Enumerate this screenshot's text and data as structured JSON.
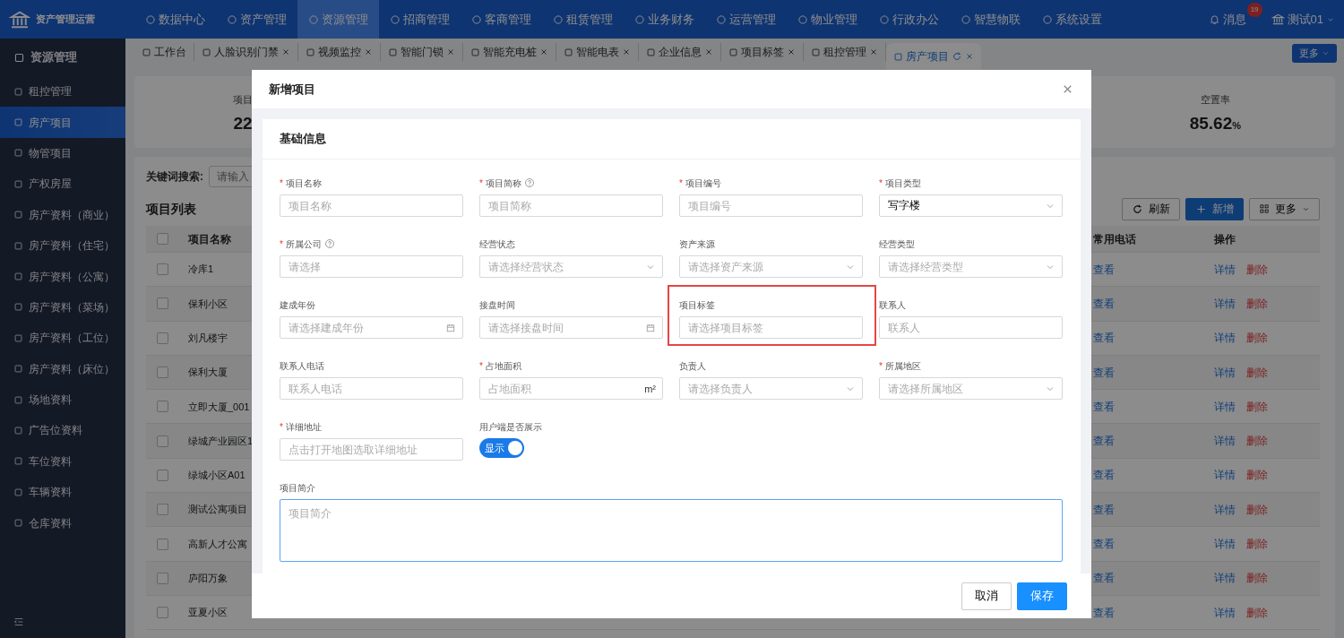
{
  "header": {
    "app_title": "资产管理运营",
    "menu": [
      {
        "label": "数据中心",
        "selected": false
      },
      {
        "label": "资产管理",
        "selected": false
      },
      {
        "label": "资源管理",
        "selected": true
      },
      {
        "label": "招商管理",
        "selected": false
      },
      {
        "label": "客商管理",
        "selected": false
      },
      {
        "label": "租赁管理",
        "selected": false
      },
      {
        "label": "业务财务",
        "selected": false
      },
      {
        "label": "运营管理",
        "selected": false
      },
      {
        "label": "物业管理",
        "selected": false
      },
      {
        "label": "行政办公",
        "selected": false
      },
      {
        "label": "智慧物联",
        "selected": false
      },
      {
        "label": "系统设置",
        "selected": false
      }
    ],
    "messages": {
      "label": "消息",
      "count": "19"
    },
    "user": "测试01"
  },
  "sidebar": {
    "title": "资源管理",
    "items": [
      {
        "label": "租控管理",
        "selected": false
      },
      {
        "label": "房产项目",
        "selected": true
      },
      {
        "label": "物管项目",
        "selected": false
      },
      {
        "label": "产权房屋",
        "selected": false
      },
      {
        "label": "房产资料（商业）",
        "selected": false
      },
      {
        "label": "房产资料（住宅）",
        "selected": false
      },
      {
        "label": "房产资料（公寓）",
        "selected": false
      },
      {
        "label": "房产资料（菜场）",
        "selected": false
      },
      {
        "label": "房产资料（工位）",
        "selected": false
      },
      {
        "label": "房产资料（床位）",
        "selected": false
      },
      {
        "label": "场地资料",
        "selected": false
      },
      {
        "label": "广告位资料",
        "selected": false
      },
      {
        "label": "车位资料",
        "selected": false
      },
      {
        "label": "车辆资料",
        "selected": false
      },
      {
        "label": "仓库资料",
        "selected": false
      }
    ]
  },
  "tabs": [
    {
      "label": "工作台",
      "selected": false,
      "closable": false
    },
    {
      "label": "人脸识别门禁",
      "selected": false,
      "closable": true
    },
    {
      "label": "视频监控",
      "selected": false,
      "closable": true
    },
    {
      "label": "智能门锁",
      "selected": false,
      "closable": true
    },
    {
      "label": "智能充电桩",
      "selected": false,
      "closable": true
    },
    {
      "label": "智能电表",
      "selected": false,
      "closable": true
    },
    {
      "label": "企业信息",
      "selected": false,
      "closable": true
    },
    {
      "label": "项目标签",
      "selected": false,
      "closable": true
    },
    {
      "label": "租控管理",
      "selected": false,
      "closable": true
    },
    {
      "label": "房产项目",
      "selected": true,
      "closable": true
    }
  ],
  "tabs_more": "更多",
  "stats": [
    {
      "label": "项目",
      "value": "22"
    },
    {
      "label": "空置率",
      "value": "85.62",
      "unit": "%"
    }
  ],
  "search": {
    "label": "关键词搜索:",
    "placeholder": "请输入"
  },
  "list": {
    "title": "项目列表",
    "buttons": [
      {
        "label": "刷新",
        "kind": "refresh"
      },
      {
        "label": "新增",
        "kind": "add"
      },
      {
        "label": "更多",
        "kind": "more"
      }
    ],
    "all_checked": false,
    "columns": [
      "项目名称",
      "常用电话",
      "操作"
    ],
    "rows": [
      {
        "name": "冷库1",
        "checked": false,
        "phone": "查看",
        "actions": [
          "详情",
          "删除"
        ]
      },
      {
        "name": "保利小区",
        "checked": false,
        "phone": "查看",
        "actions": [
          "详情",
          "删除"
        ]
      },
      {
        "name": "刘凡楼宇",
        "checked": false,
        "phone": "查看",
        "actions": [
          "详情",
          "删除"
        ]
      },
      {
        "name": "保利大厦",
        "checked": false,
        "phone": "查看",
        "actions": [
          "详情",
          "删除"
        ]
      },
      {
        "name": "立即大厦_001",
        "checked": false,
        "phone": "查看",
        "actions": [
          "详情",
          "删除"
        ]
      },
      {
        "name": "绿城产业园区1",
        "checked": false,
        "phone": "查看",
        "actions": [
          "详情",
          "删除"
        ]
      },
      {
        "name": "绿城小区A01",
        "checked": false,
        "phone": "查看",
        "actions": [
          "详情",
          "删除"
        ]
      },
      {
        "name": "测试公寓项目",
        "checked": false,
        "phone": "查看",
        "actions": [
          "详情",
          "删除"
        ]
      },
      {
        "name": "高新人才公寓",
        "checked": false,
        "phone": "查看",
        "actions": [
          "详情",
          "删除"
        ]
      },
      {
        "name": "庐阳万象",
        "checked": false,
        "phone": "查看",
        "actions": [
          "详情",
          "删除"
        ]
      },
      {
        "name": "亚夏小区",
        "checked": false,
        "phone": "查看",
        "actions": [
          "详情",
          "删除"
        ]
      }
    ]
  },
  "dialog": {
    "title": "新增项目",
    "section": "基础信息",
    "fields": [
      {
        "kind": "text",
        "required_mark": "*",
        "label": "项目名称",
        "help": false,
        "placeholder": "项目名称"
      },
      {
        "kind": "text",
        "required_mark": "*",
        "label": "项目简称",
        "help": true,
        "placeholder": "项目简称"
      },
      {
        "kind": "text",
        "required_mark": "*",
        "label": "项目编号",
        "help": false,
        "placeholder": "项目编号"
      },
      {
        "kind": "select",
        "required_mark": "*",
        "label": "项目类型",
        "help": false,
        "value": "写字楼"
      },
      {
        "kind": "text",
        "required_mark": "*",
        "label": "所属公司",
        "help": true,
        "placeholder": "请选择"
      },
      {
        "kind": "select",
        "label": "经营状态",
        "help": false,
        "placeholder": "请选择经营状态"
      },
      {
        "kind": "select",
        "label": "资产来源",
        "help": false,
        "placeholder": "请选择资产来源"
      },
      {
        "kind": "select",
        "label": "经营类型",
        "help": false,
        "placeholder": "请选择经营类型"
      },
      {
        "kind": "date",
        "label": "建成年份",
        "help": false,
        "placeholder": "请选择建成年份"
      },
      {
        "kind": "date",
        "label": "接盘时间",
        "help": false,
        "placeholder": "请选择接盘时间"
      },
      {
        "kind": "text",
        "label": "项目标签",
        "help": false,
        "placeholder": "请选择项目标签",
        "highlighted": true
      },
      {
        "kind": "text",
        "label": "联系人",
        "help": false,
        "placeholder": "联系人"
      },
      {
        "kind": "text",
        "label": "联系人电话",
        "help": false,
        "placeholder": "联系人电话"
      },
      {
        "kind": "suffix",
        "required_mark": "*",
        "label": "占地面积",
        "help": false,
        "placeholder": "占地面积",
        "suffix": "m²"
      },
      {
        "kind": "select",
        "label": "负责人",
        "help": false,
        "placeholder": "请选择负责人"
      },
      {
        "kind": "select",
        "required_mark": "*",
        "label": "所属地区",
        "help": false,
        "placeholder": "请选择所属地区"
      },
      {
        "kind": "text",
        "required_mark": "*",
        "label": "详细地址",
        "help": false,
        "placeholder": "点击打开地图选取详细地址"
      },
      {
        "kind": "switch",
        "label": "用户端是否展示",
        "help": false,
        "on": true,
        "text": "显示"
      },
      {
        "kind": "textarea",
        "label": "项目简介",
        "help": false,
        "placeholder": "项目简介",
        "focused": true
      }
    ],
    "buttons": [
      {
        "label": "取消",
        "kind": "cancel"
      },
      {
        "label": "保存",
        "kind": "primary"
      }
    ]
  }
}
